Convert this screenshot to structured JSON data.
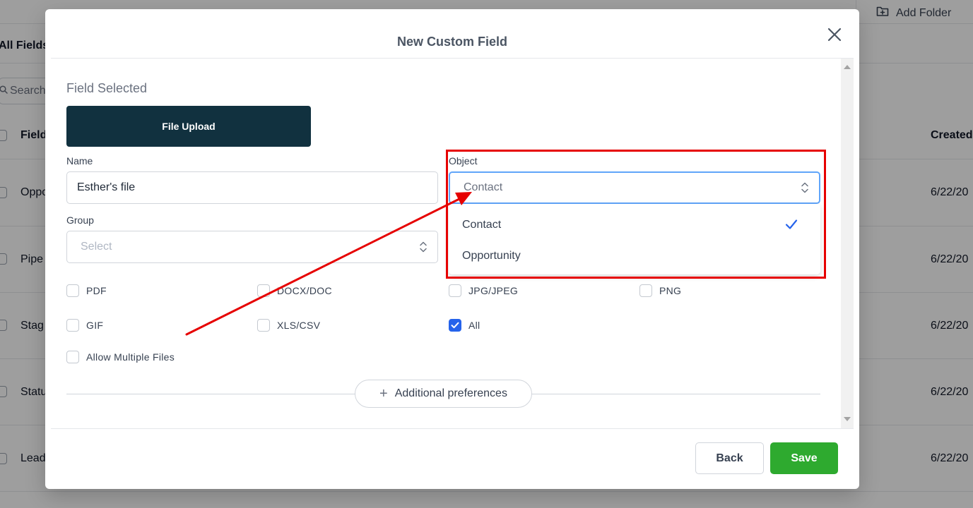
{
  "background": {
    "add_folder_label": "Add Folder",
    "tab_label": "All Fields",
    "search_placeholder": "Search",
    "col_field": "Field",
    "col_created": "Created",
    "rows": [
      {
        "name": "Oppo",
        "date": "6/22/20"
      },
      {
        "name": "Pipe",
        "date": "6/22/20"
      },
      {
        "name": "Stag",
        "date": "6/22/20"
      },
      {
        "name": "Statu",
        "date": "6/22/20"
      },
      {
        "name": "Lead",
        "date": "6/22/20"
      }
    ]
  },
  "modal": {
    "title": "New Custom Field",
    "field_selected_label": "Field Selected",
    "field_type": "File Upload",
    "name_label": "Name",
    "name_value": "Esther's file",
    "object_label": "Object",
    "object_value": "Contact",
    "object_options": [
      {
        "label": "Contact",
        "selected": true
      },
      {
        "label": "Opportunity",
        "selected": false
      }
    ],
    "group_label": "Group",
    "group_placeholder": "Select",
    "file_types": [
      {
        "label": "PDF",
        "checked": false
      },
      {
        "label": "DOCX/DOC",
        "checked": false
      },
      {
        "label": "JPG/JPEG",
        "checked": false
      },
      {
        "label": "PNG",
        "checked": false
      },
      {
        "label": "GIF",
        "checked": false
      },
      {
        "label": "XLS/CSV",
        "checked": false
      },
      {
        "label": "All",
        "checked": true
      }
    ],
    "allow_multiple_label": "Allow Multiple Files",
    "additional_preferences_label": "Additional preferences",
    "back_label": "Back",
    "save_label": "Save"
  },
  "colors": {
    "accent_blue": "#2563eb",
    "save_green": "#2eaa2f",
    "field_card": "#11313f",
    "annotation_red": "#e60000"
  }
}
